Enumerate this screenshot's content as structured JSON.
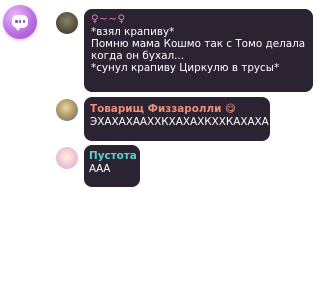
{
  "fab": {
    "icon": "chat-bubble-icon"
  },
  "messages": [
    {
      "avatar": "user-avatar",
      "name": "♀~~♀",
      "name_color": "#e879c8",
      "lines": [
        "*взял крапиву*",
        "Помню мама Кошмо так с Томо делала",
        "когда он бухал...",
        "*сунул крапиву Циркулю в трусы*"
      ]
    },
    {
      "avatar": "user-avatar",
      "name": "Товарищ Физзаролли",
      "name_emoji": "😋",
      "name_color": "#f08c7a",
      "lines": [
        "ЭХАХАХААХХКХАХАХКХХКАХАХА"
      ]
    },
    {
      "avatar": "user-avatar",
      "name": "Пустота",
      "name_color": "#58d4c8",
      "lines": [
        "ААА"
      ]
    }
  ]
}
